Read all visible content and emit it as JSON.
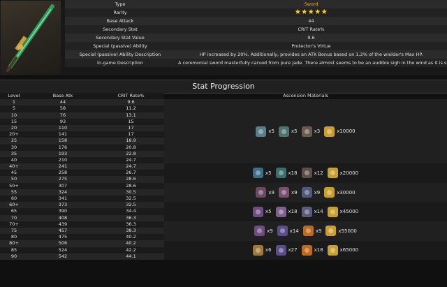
{
  "info": {
    "rows": [
      {
        "label": "Type",
        "value": "Sword"
      },
      {
        "label": "Rarity",
        "value": "★★★★★"
      },
      {
        "label": "Base Attack",
        "value": "44"
      },
      {
        "label": "Secondary Stat",
        "value": "CRIT Rate%"
      },
      {
        "label": "Secondary Stat Value",
        "value": "9.6"
      },
      {
        "label": "Special (passive) Ability",
        "value": "Protector's Virtue"
      },
      {
        "label": "Special (passive) Ability Description",
        "value": "HP increased by 20%. Additionally, provides an ATK Bonus based on 1.2% of the wielder's Max HP."
      },
      {
        "label": "In-game Description",
        "value": "A ceremonial sword masterfully carved from pure jade. There almost seems to be an audible sigh in the wind as it is swung."
      }
    ]
  },
  "progression": {
    "title": "Stat Progression",
    "headers": {
      "level": "Level",
      "atk": "Base Atk",
      "crit": "CRIT Rate%",
      "asc": "Ascension Materials"
    },
    "rows": [
      [
        "1",
        "44",
        "9.6"
      ],
      [
        "5",
        "58",
        "11.2"
      ],
      [
        "10",
        "76",
        "13.1"
      ],
      [
        "15",
        "93",
        "15"
      ],
      [
        "20",
        "110",
        "17"
      ],
      [
        "20+",
        "141",
        "17"
      ],
      [
        "25",
        "158",
        "18.9"
      ],
      [
        "30",
        "176",
        "20.8"
      ],
      [
        "35",
        "193",
        "22.8"
      ],
      [
        "40",
        "210",
        "24.7"
      ],
      [
        "40+",
        "241",
        "24.7"
      ],
      [
        "45",
        "258",
        "26.7"
      ],
      [
        "50",
        "275",
        "28.6"
      ],
      [
        "50+",
        "307",
        "28.6"
      ],
      [
        "55",
        "324",
        "30.5"
      ],
      [
        "60",
        "341",
        "32.5"
      ],
      [
        "60+",
        "373",
        "32.5"
      ],
      [
        "65",
        "390",
        "34.4"
      ],
      [
        "70",
        "408",
        "36.3"
      ],
      [
        "70+",
        "439",
        "36.3"
      ],
      [
        "75",
        "457",
        "38.3"
      ],
      [
        "80",
        "475",
        "40.2"
      ],
      [
        "80+",
        "506",
        "40.2"
      ],
      [
        "85",
        "524",
        "42.2"
      ],
      [
        "90",
        "542",
        "44.1"
      ]
    ],
    "ascensions": [
      {
        "rows": [
          0,
          10
        ],
        "mats": [
          {
            "icon": "sapling-icon",
            "color": "#5a7f8a",
            "qty": "x5"
          },
          {
            "icon": "arrowhead-icon",
            "color": "#4e7470",
            "qty": "x5"
          },
          {
            "icon": "claw-icon",
            "color": "#6b5a50",
            "qty": "x3"
          },
          {
            "icon": "mora-icon",
            "color": "#c9a030",
            "qty": "x10000"
          }
        ]
      },
      {
        "rows": [
          10,
          13
        ],
        "mats": [
          {
            "icon": "sapling-icon",
            "color": "#3f6d85",
            "qty": "x5"
          },
          {
            "icon": "arrowhead-icon",
            "color": "#3a6e6c",
            "qty": "x18"
          },
          {
            "icon": "claw-icon",
            "color": "#5d4e4a",
            "qty": "x12"
          },
          {
            "icon": "mora-icon",
            "color": "#c9a030",
            "qty": "x20000"
          }
        ]
      },
      {
        "rows": [
          13,
          16
        ],
        "mats": [
          {
            "icon": "sapling-icon",
            "color": "#6a4a63",
            "qty": "x9"
          },
          {
            "icon": "arrowhead-icon",
            "color": "#7a4f6f",
            "qty": "x9"
          },
          {
            "icon": "claw-icon",
            "color": "#4f5a7a",
            "qty": "x9"
          },
          {
            "icon": "mora-icon",
            "color": "#c9a030",
            "qty": "x30000"
          }
        ]
      },
      {
        "rows": [
          16,
          19
        ],
        "mats": [
          {
            "icon": "sapling-icon",
            "color": "#6f4d7f",
            "qty": "x5"
          },
          {
            "icon": "arrowhead-icon",
            "color": "#7f5f8e",
            "qty": "x18"
          },
          {
            "icon": "claw-icon",
            "color": "#5a5a7a",
            "qty": "x14"
          },
          {
            "icon": "mora-icon",
            "color": "#c9a030",
            "qty": "x45000"
          }
        ]
      },
      {
        "rows": [
          19,
          22
        ],
        "mats": [
          {
            "icon": "sapling-icon",
            "color": "#6f4d7f",
            "qty": "x9"
          },
          {
            "icon": "arrowhead-icon",
            "color": "#5b4c8a",
            "qty": "x14"
          },
          {
            "icon": "claw-icon",
            "color": "#c06a20",
            "qty": "x9"
          },
          {
            "icon": "mora-icon",
            "color": "#c9a030",
            "qty": "x55000"
          }
        ]
      },
      {
        "rows": [
          22,
          25
        ],
        "mats": [
          {
            "icon": "sapling-icon",
            "color": "#a07a3a",
            "qty": "x6"
          },
          {
            "icon": "arrowhead-icon",
            "color": "#5b4c8a",
            "qty": "x27"
          },
          {
            "icon": "claw-icon",
            "color": "#c06a20",
            "qty": "x18"
          },
          {
            "icon": "mora-icon",
            "color": "#c9a030",
            "qty": "x65000"
          }
        ]
      }
    ]
  }
}
